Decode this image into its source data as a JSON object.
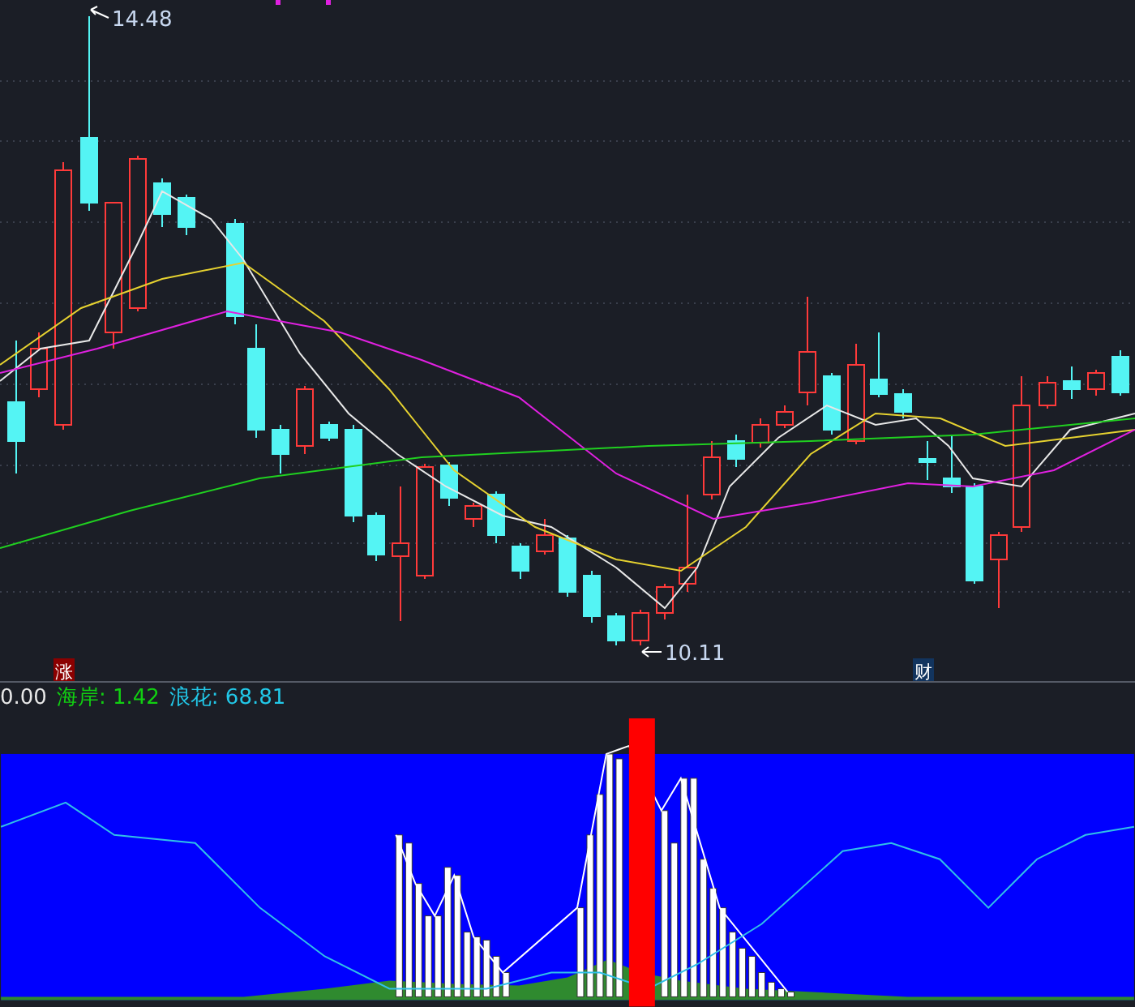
{
  "price_chart": {
    "high_label": "14.48",
    "low_label": "10.11",
    "markers": [
      {
        "text": "涨",
        "color": "#8b0000"
      },
      {
        "text": "财",
        "color": "#12345e"
      }
    ]
  },
  "indicator": {
    "legend": [
      {
        "text": "0.00",
        "color": "#e8e8e8"
      },
      {
        "text": "海岸: 1.42",
        "color": "#11d011"
      },
      {
        "text": "浪花: 68.81",
        "color": "#22c8e8"
      }
    ]
  }
}
